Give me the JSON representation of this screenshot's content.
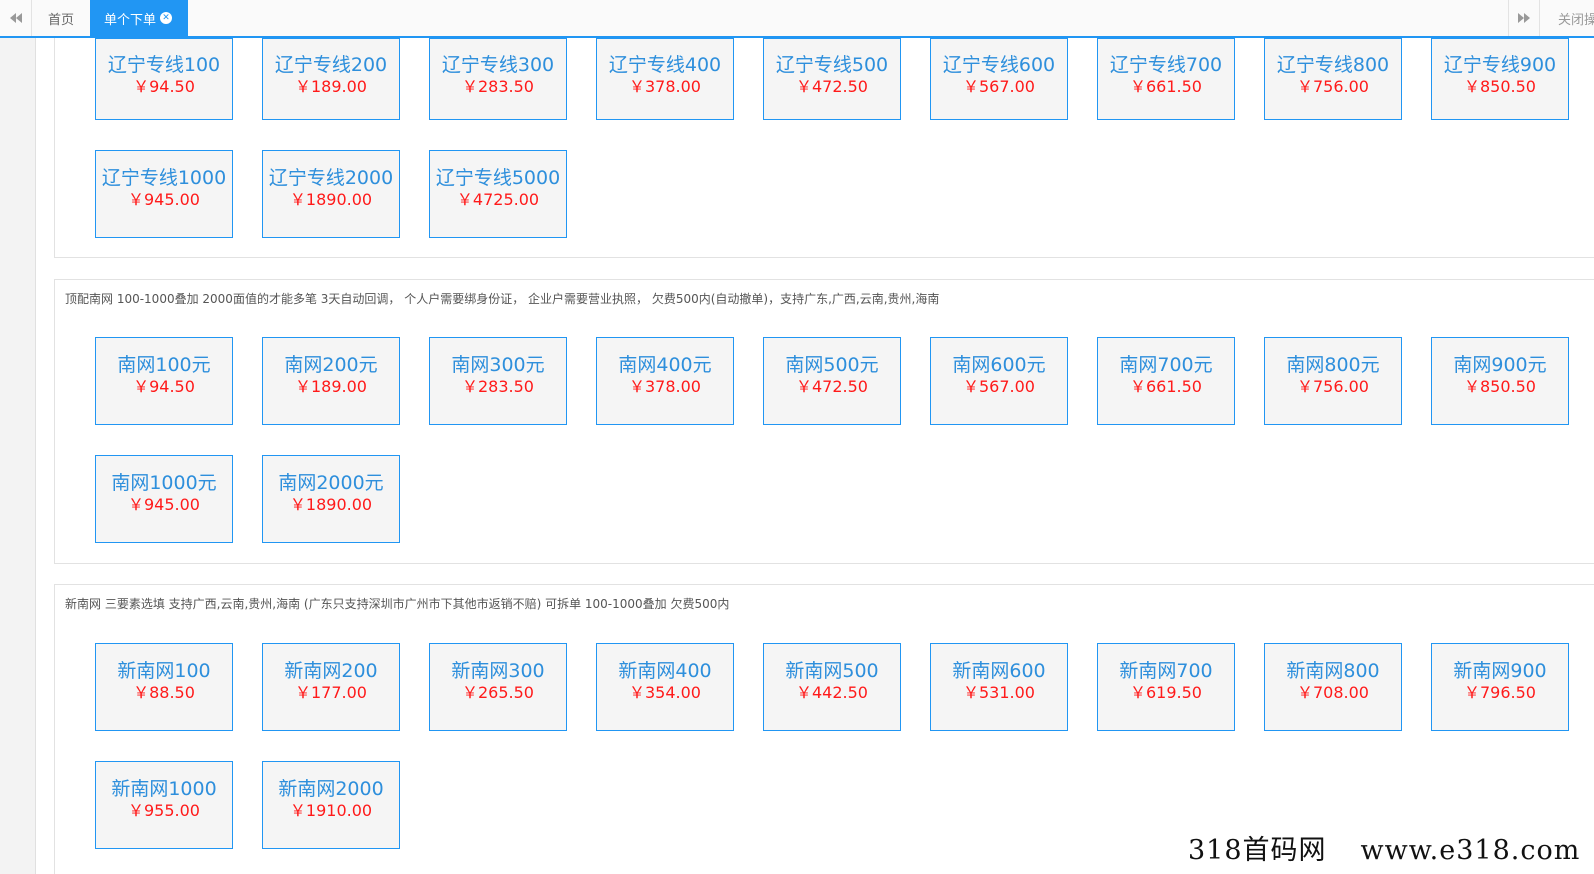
{
  "tabs": {
    "home": "首页",
    "active": "单个下单",
    "close_ops": "关闭操作"
  },
  "sections": [
    {
      "description": "",
      "cards": [
        {
          "name": "辽宁专线100",
          "price": "￥94.50"
        },
        {
          "name": "辽宁专线200",
          "price": "￥189.00"
        },
        {
          "name": "辽宁专线300",
          "price": "￥283.50"
        },
        {
          "name": "辽宁专线400",
          "price": "￥378.00"
        },
        {
          "name": "辽宁专线500",
          "price": "￥472.50"
        },
        {
          "name": "辽宁专线600",
          "price": "￥567.00"
        },
        {
          "name": "辽宁专线700",
          "price": "￥661.50"
        },
        {
          "name": "辽宁专线800",
          "price": "￥756.00"
        },
        {
          "name": "辽宁专线900",
          "price": "￥850.50"
        },
        {
          "name": "辽宁专线1000",
          "price": "￥945.00"
        },
        {
          "name": "辽宁专线2000",
          "price": "￥1890.00"
        },
        {
          "name": "辽宁专线5000",
          "price": "￥4725.00"
        }
      ]
    },
    {
      "description": "顶配南网 100-1000叠加 2000面值的才能多笔 3天自动回调， 个人户需要绑身份证， 企业户需要营业执照， 欠费500内(自动撤单)，支持广东,广西,云南,贵州,海南",
      "cards": [
        {
          "name": "南网100元",
          "price": "￥94.50"
        },
        {
          "name": "南网200元",
          "price": "￥189.00"
        },
        {
          "name": "南网300元",
          "price": "￥283.50"
        },
        {
          "name": "南网400元",
          "price": "￥378.00"
        },
        {
          "name": "南网500元",
          "price": "￥472.50"
        },
        {
          "name": "南网600元",
          "price": "￥567.00"
        },
        {
          "name": "南网700元",
          "price": "￥661.50"
        },
        {
          "name": "南网800元",
          "price": "￥756.00"
        },
        {
          "name": "南网900元",
          "price": "￥850.50"
        },
        {
          "name": "南网1000元",
          "price": "￥945.00"
        },
        {
          "name": "南网2000元",
          "price": "￥1890.00"
        }
      ]
    },
    {
      "description": "新南网 三要素选填 支持广西,云南,贵州,海南 (广东只支持深圳市广州市下其他市返销不赔) 可拆单 100-1000叠加 欠费500内",
      "cards": [
        {
          "name": "新南网100",
          "price": "￥88.50"
        },
        {
          "name": "新南网200",
          "price": "￥177.00"
        },
        {
          "name": "新南网300",
          "price": "￥265.50"
        },
        {
          "name": "新南网400",
          "price": "￥354.00"
        },
        {
          "name": "新南网500",
          "price": "￥442.50"
        },
        {
          "name": "新南网600",
          "price": "￥531.00"
        },
        {
          "name": "新南网700",
          "price": "￥619.50"
        },
        {
          "name": "新南网800",
          "price": "￥708.00"
        },
        {
          "name": "新南网900",
          "price": "￥796.50"
        },
        {
          "name": "新南网1000",
          "price": "￥955.00"
        },
        {
          "name": "新南网2000",
          "price": "￥1910.00"
        }
      ]
    }
  ],
  "watermark": {
    "name": "318首码网",
    "url": "www.e318.com"
  },
  "colors": {
    "accent": "#2196f3",
    "card_text": "#2e8fdc",
    "price": "#ff1a1a"
  },
  "icons": {
    "prev": "double-chevron-left-icon",
    "next": "double-chevron-right-icon",
    "close": "close-circle-icon"
  }
}
